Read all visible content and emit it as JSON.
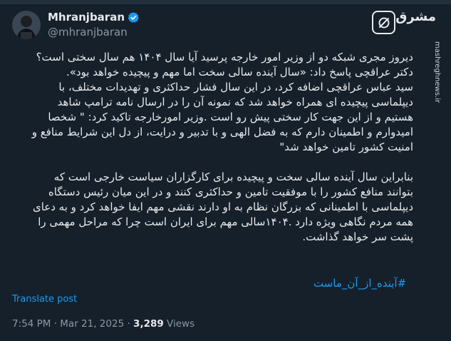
{
  "author": {
    "name": "Mhranjbaran",
    "handle": "@mhranjbaran",
    "verified": true,
    "avatar_icon": "person-avatar"
  },
  "brand": {
    "word": "مشرق",
    "url": "mashreghnews.ir",
    "logo_icon": "mashregh-logo-icon"
  },
  "tweet": {
    "lines": [
      "دیروز مجری شبکه دو از وزیر امور خارجه پرسید آیا سال ۱۴۰۴ هم سال سختی است؟",
      "دکتر عراقچی پاسخ داد: «سال آینده سالی سخت اما مهم و پیچیده خواهد بود».",
      "سید عباس عراقچی اضافه کرد، در این سال فشار حداکثری و تهدیدات مختلف، با",
      "دیپلماسی پیچیده ای همراه خواهد شد که نمونه آن را در ارسال نامه ترامپ شاهد",
      "هستیم و از این جهت کار سختی پیش رو است .وزیر امورخارجه تاکید کرد: \" شخصا",
      "امیدوارم و اطمینان دارم که به فضل الهی و با تدبیر و درایت، از دل این شرایط منافع و",
      "امنیت کشور تامین خواهد شد\"",
      "",
      "بنابراین سال آینده سالی سخت و پیچیده برای کارگزاران سیاست خارجی است که",
      "بتوانند منافع کشور را با موفقیت تامین و حداکثری کنند و در این میان رئیس دستگاه",
      "دیپلماسی با اطمینانی که بزرگان نظام به او دارند نقشی مهم ایفا خواهد کرد و به دعای",
      "همه مردم نگاهی ویژه دارد .۱۴۰۴سالی مهم برای ایران است چرا که مراحل مهمی را",
      "پشت سر خواهد گذاشت."
    ],
    "hashtag": "#آینده_از_آن_ماست"
  },
  "translate_label": "Translate post",
  "meta": {
    "time": "7:54 PM",
    "sep1": " · ",
    "date": "Mar 21, 2025",
    "sep2": " · ",
    "views": "3,289",
    "views_label": " Views"
  },
  "colors": {
    "background": "#15202b",
    "text": "#e7e9ea",
    "muted": "#8b98a5",
    "link": "#1d9bf0"
  }
}
